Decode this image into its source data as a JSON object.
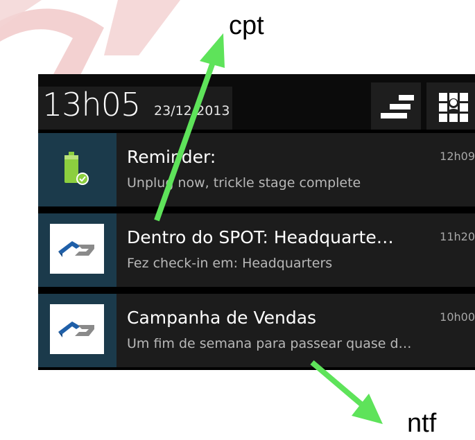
{
  "annotations": {
    "top_label": "cpt",
    "bottom_label": "ntf",
    "arrow_color": "#5ee35a",
    "watermark_color": "#e6a3a3"
  },
  "status_bar": {
    "time": "13h05",
    "date": "23/12/2013",
    "clear_button_icon": "clear-all-icon",
    "settings_button_icon": "quick-settings-icon"
  },
  "notifications": [
    {
      "icon": "battery-charged-icon",
      "title": "Reminder:",
      "subtitle": "Unplug now, trickle stage complete",
      "time": "12h09"
    },
    {
      "icon": "app-logo-icon",
      "title": "Dentro do SPOT: Headquarte…",
      "subtitle": "Fez check-in em: Headquarters",
      "time": "11h20"
    },
    {
      "icon": "app-logo-icon",
      "title": "Campanha de Vendas",
      "subtitle": "Um fim de semana para passear quase d…",
      "time": "10h00"
    }
  ],
  "colors": {
    "panel_bg": "#000000",
    "notification_bg": "#1c1c1c",
    "icon_tile_bg": "#1b3a4b",
    "logo_blue": "#1f5fa8",
    "logo_gray": "#8a8a8a",
    "battery_green": "#8ccf3f"
  }
}
